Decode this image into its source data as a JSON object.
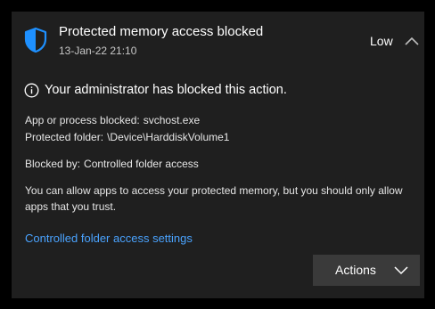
{
  "notification": {
    "title": "Protected memory access blocked",
    "timestamp": "13-Jan-22 21:10",
    "severity": "Low",
    "headline": "Your administrator has blocked this action.",
    "details": {
      "app_label": "App or process blocked:",
      "app_value": "svchost.exe",
      "folder_label": "Protected folder:",
      "folder_value": "\\Device\\HarddiskVolume1",
      "blocked_by_label": "Blocked by:",
      "blocked_by_value": "Controlled folder access"
    },
    "message": "You can allow apps to access your protected memory, but you should only allow apps that you trust.",
    "link": "Controlled folder access settings",
    "actions_label": "Actions"
  },
  "icons": {
    "header": "shield-icon",
    "collapse": "chevron-up-icon",
    "headline": "info-icon",
    "actions": "chevron-down-icon"
  },
  "colors": {
    "background": "#000000",
    "card": "#1f1f1f",
    "accent": "#1e90ff",
    "link": "#4aa3ff",
    "button": "#3a3a3a"
  }
}
